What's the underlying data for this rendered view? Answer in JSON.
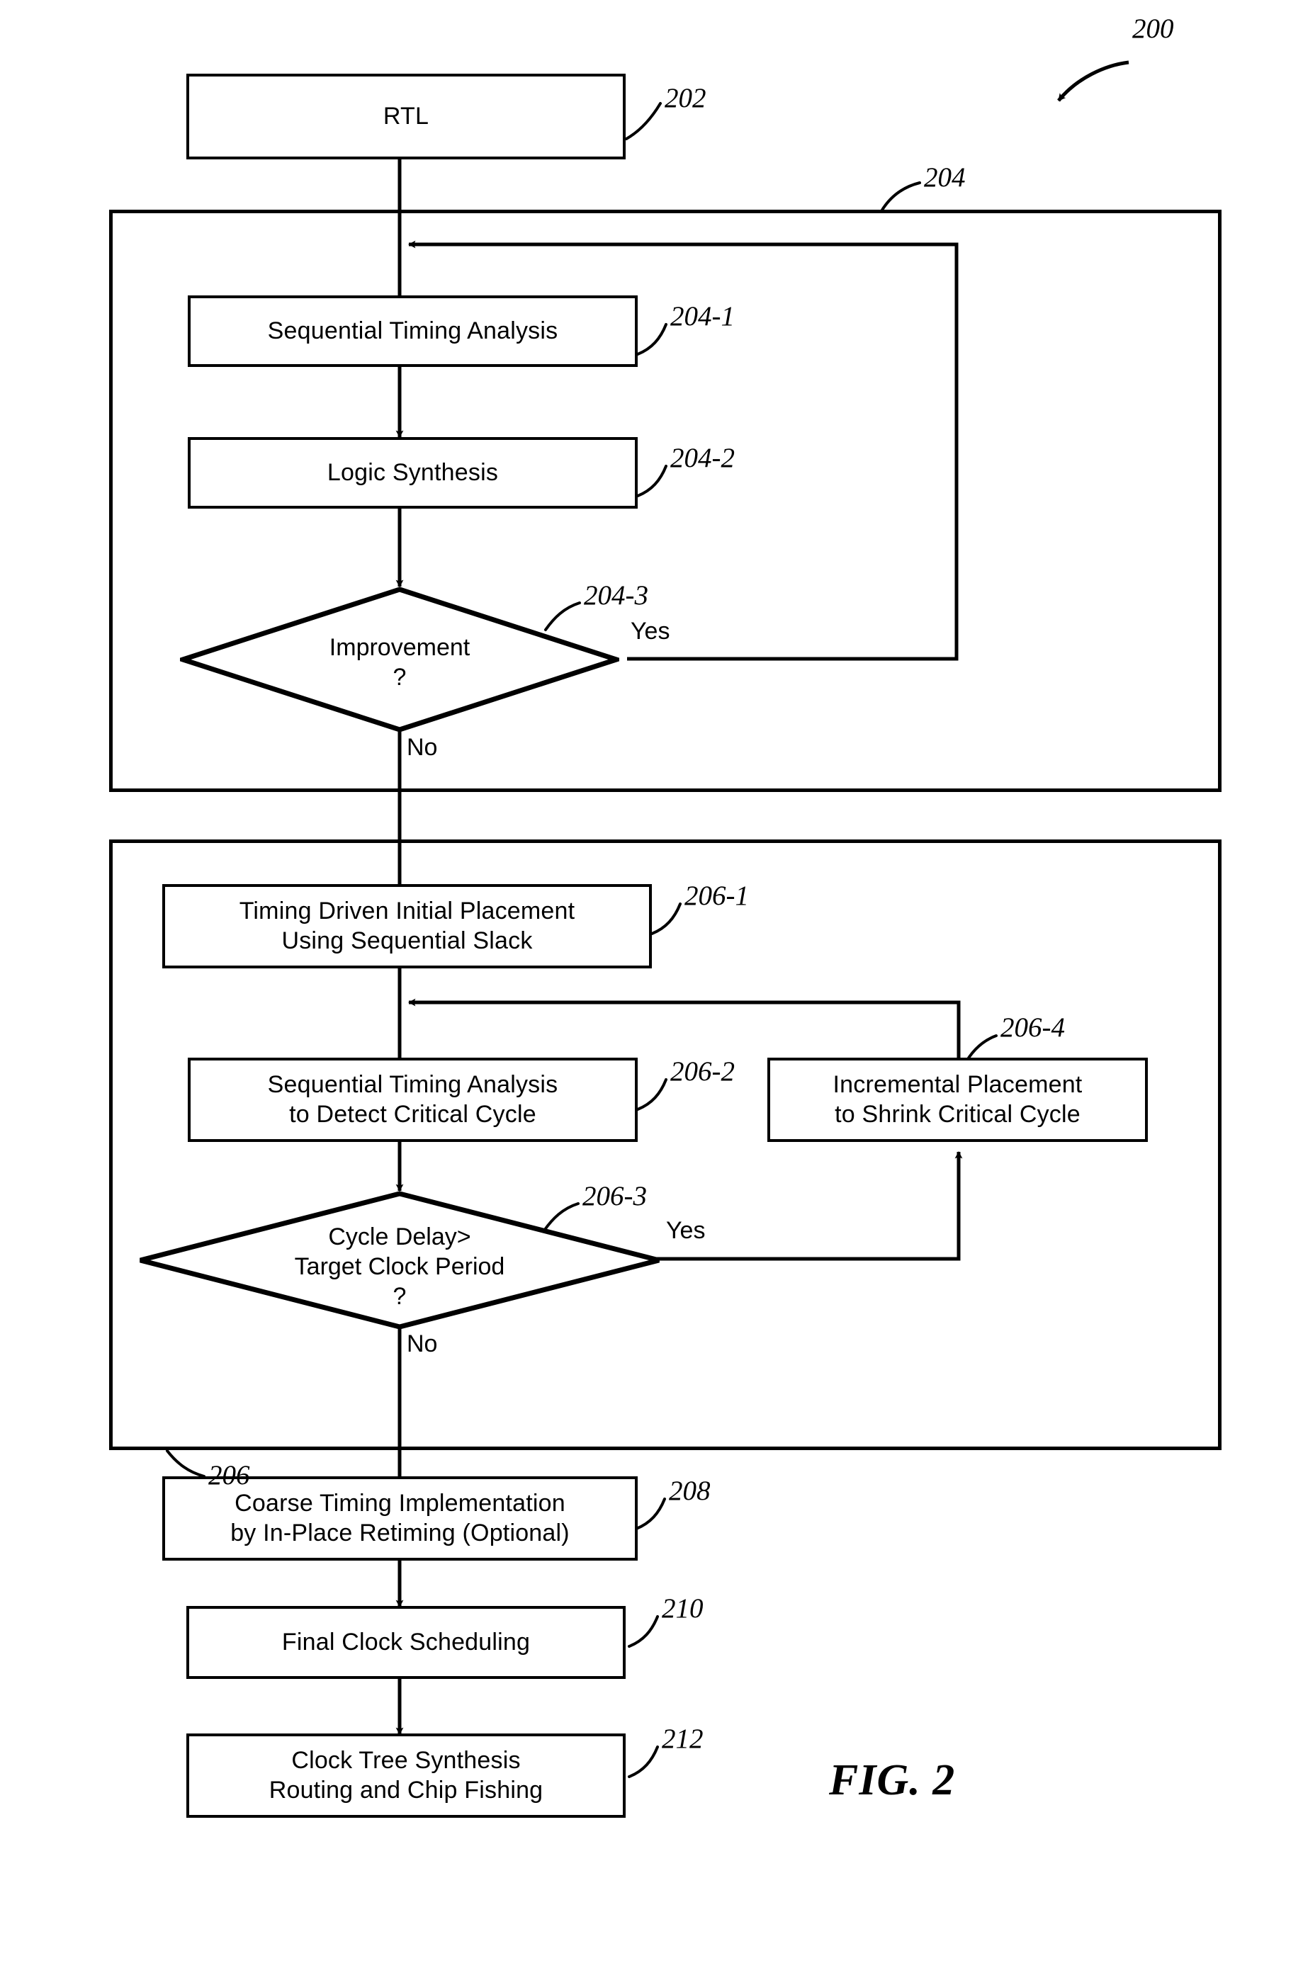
{
  "figure": {
    "caption": "FIG. 2",
    "overall_ref": "200"
  },
  "nodes": [
    {
      "id": "rtl",
      "ref": "202",
      "line1": "RTL",
      "line2": ""
    },
    {
      "id": "sequential-timing-analysis",
      "ref": "204-1",
      "line1": "Sequential Timing Analysis",
      "line2": ""
    },
    {
      "id": "logic-synthesis",
      "ref": "204-2",
      "line1": "Logic Synthesis",
      "line2": ""
    },
    {
      "id": "timing-driven-initial-placement",
      "ref": "206-1",
      "line1": "Timing Driven Initial Placement",
      "line2": "Using Sequential Slack"
    },
    {
      "id": "sequential-timing-analysis-critical-cycle",
      "ref": "206-2",
      "line1": "Sequential Timing Analysis",
      "line2": "to Detect Critical Cycle"
    },
    {
      "id": "incremental-placement",
      "ref": "206-4",
      "line1": "Incremental Placement",
      "line2": "to Shrink Critical Cycle"
    },
    {
      "id": "coarse-timing-implementation",
      "ref": "208",
      "line1": "Coarse Timing Implementation",
      "line2": "by In-Place Retiming (Optional)"
    },
    {
      "id": "final-clock-scheduling",
      "ref": "210",
      "line1": "Final Clock Scheduling",
      "line2": ""
    },
    {
      "id": "clock-tree-synthesis",
      "ref": "212",
      "line1": "Clock Tree Synthesis",
      "line2": "Routing and Chip Fishing"
    }
  ],
  "decisions": [
    {
      "id": "improvement",
      "ref": "204-3",
      "line1": "Improvement",
      "line2": "?",
      "line3": "",
      "yes_label": "Yes",
      "no_label": "No"
    },
    {
      "id": "cycle-delay",
      "ref": "206-3",
      "line1": "Cycle Delay>",
      "line2": "Target Clock Period",
      "line3": "?",
      "yes_label": "Yes",
      "no_label": "No"
    }
  ],
  "containers": [
    {
      "id": "synthesis-stage",
      "ref": "204"
    },
    {
      "id": "placement-stage",
      "ref": "206"
    }
  ],
  "colors": {
    "stroke": "#000000",
    "background": "#ffffff",
    "text": "#000000"
  }
}
